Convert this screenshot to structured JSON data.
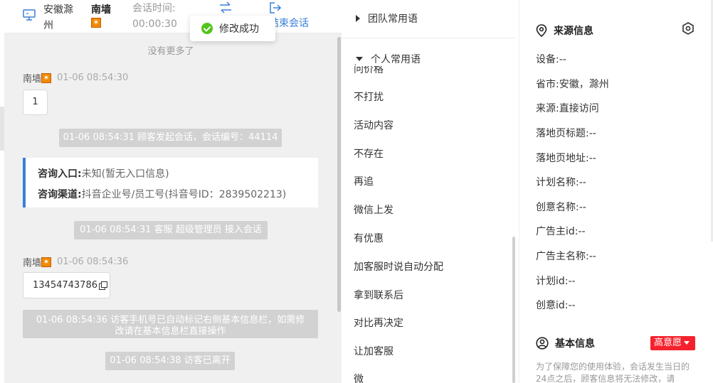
{
  "header": {
    "location": "安徽滁州",
    "customer_name": "南墙",
    "session_label": "会话时间:",
    "session_time": "00:00:30",
    "end_label": "结束会话"
  },
  "toast": {
    "text": "修改成功"
  },
  "chat": {
    "no_more": "没有更多了",
    "messages": [
      {
        "sender": "南墙",
        "time": "01-06 08:54:30",
        "content": "1"
      },
      {
        "sender": "南墙",
        "time": "01-06 08:54:36",
        "content": "13454743786"
      }
    ],
    "system": [
      "01-06 08:54:31 顾客发起会话，会话编号：44114",
      "01-06 08:54:31 客服 超级管理员 接入会话",
      "01-06 08:54:36 访客手机号已自动标记右侧基本信息栏，如需修改请在基本信息栏直接操作",
      "01-06 08:54:38 访客已离开"
    ],
    "info_card": {
      "entry_label": "咨询入口:",
      "entry_value": "未知(暂无入口信息)",
      "channel_label": "咨询渠道:",
      "channel_value": "抖音企业号/员工号(抖音号ID：2839502213)"
    }
  },
  "phrases": {
    "team_label": "团队常用语",
    "personal_label": "个人常用语",
    "partial_top": "问价格",
    "items": [
      "不打扰",
      "活动内容",
      "不存在",
      "再追",
      "微信上发",
      "有优惠",
      "加客服时说自动分配",
      "拿到联系后",
      "对比再决定",
      "让加客服",
      "微"
    ]
  },
  "source_info": {
    "title": "来源信息",
    "fields": [
      {
        "label": "设备:",
        "value": "--"
      },
      {
        "label": "省市:",
        "value": "安徽，滁州"
      },
      {
        "label": "来源:",
        "value": "直接访问"
      },
      {
        "label": "落地页标题:",
        "value": "--"
      },
      {
        "label": "落地页地址:",
        "value": "--"
      },
      {
        "label": "计划名称:",
        "value": "--"
      },
      {
        "label": "创意名称:",
        "value": "--"
      },
      {
        "label": "广告主id:",
        "value": "--"
      },
      {
        "label": "广告主名称:",
        "value": "--"
      },
      {
        "label": "计划id:",
        "value": "--"
      },
      {
        "label": "创意id:",
        "value": "--"
      }
    ]
  },
  "basic_info": {
    "title": "基本信息",
    "intent": "高意愿",
    "notice": "为了保障您的使用体验，会话发生当日的24点之后，顾客信息将无法修改，请"
  },
  "colors": {
    "accent": "#3a7fd8",
    "success": "#52c41a",
    "danger": "#f5222d",
    "badge": "#f08a00"
  }
}
